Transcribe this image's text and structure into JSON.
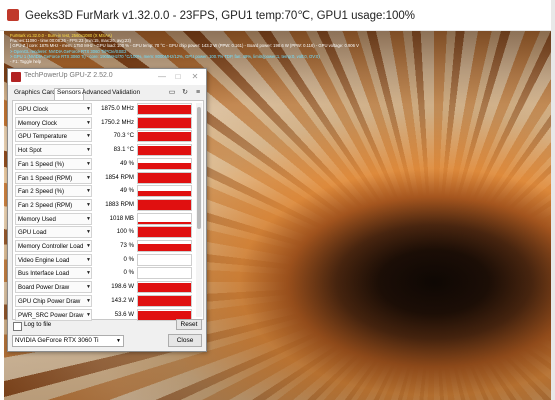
{
  "furmark": {
    "title": "Geeks3D FurMark v1.32.0.0 - 23FPS, GPU1 temp:70℃, GPU1 usage:100%",
    "overlay": [
      {
        "text": "FurMark v1.32.0.0 - Burn-in test, 2560x1080 (X MSAA)",
        "color": "yellow"
      },
      {
        "text": "Frames:11090 - time:00:08:26 - FPS:23 (min:15, max:26, avg:23)",
        "color": "white"
      },
      {
        "text": "[ GPU-Z ] core: 1875 MHz - mem: 1750 MHz - GPU load: 100 % - GPU temp: 70 °C - GPU chip power: 143.2 W (PPW: 0.161) - Board power: 198.6 W (PPW: 0.116) - GPU voltage: 0.906 V",
        "color": "white"
      },
      {
        "text": "> OpenGL renderer: NVIDIA GeForce RTX 3060 Ti/PCIe/SSE2",
        "color": "cyan"
      },
      {
        "text": "> GPU 1 (NVIDIA GeForce RTX 3060 Ti) - core: 1905MHz/70 °C/100%, mem: 8000MHz/12%, GPU power: 100.7% TDP, fan: 49%, limits(power:1, temp:0, volt:0, OV:0)",
        "color": "cyan"
      },
      {
        "text": "- F1: Toggle help",
        "color": "white"
      }
    ]
  },
  "gpuz": {
    "title": "TechPowerUp GPU-Z 2.52.0",
    "window_buttons": [
      "—",
      "□",
      "✕"
    ],
    "tabs": [
      "Graphics Card",
      "Sensors",
      "Advanced",
      "Validation"
    ],
    "active_tab": "Sensors",
    "sensors": [
      {
        "name": "GPU Clock",
        "value": "1875.0 MHz",
        "level": 0.95
      },
      {
        "name": "Memory Clock",
        "value": "1750.2 MHz",
        "level": 0.95
      },
      {
        "name": "GPU Temperature",
        "value": "70.3 °C",
        "level": 0.9
      },
      {
        "name": "Hot Spot",
        "value": "83.1 °C",
        "level": 0.9
      },
      {
        "name": "Fan 1 Speed (%)",
        "value": "49 %",
        "level": 0.55
      },
      {
        "name": "Fan 1 Speed (RPM)",
        "value": "1854 RPM",
        "level": 0.95
      },
      {
        "name": "Fan 2 Speed (%)",
        "value": "49 %",
        "level": 0.55
      },
      {
        "name": "Fan 2 Speed (RPM)",
        "value": "1883 RPM",
        "level": 0.95
      },
      {
        "name": "Memory Used",
        "value": "1018 MB",
        "level": 0.12
      },
      {
        "name": "GPU Load",
        "value": "100 %",
        "level": 1.0
      },
      {
        "name": "Memory Controller Load",
        "value": "73 %",
        "level": 0.73
      },
      {
        "name": "Video Engine Load",
        "value": "0 %",
        "level": 0.0
      },
      {
        "name": "Bus Interface Load",
        "value": "0 %",
        "level": 0.0
      },
      {
        "name": "Board Power Draw",
        "value": "198.6 W",
        "level": 0.95
      },
      {
        "name": "GPU Chip Power Draw",
        "value": "143.2 W",
        "level": 0.95
      },
      {
        "name": "PWR_SRC Power Draw",
        "value": "53.6 W",
        "level": 0.85
      }
    ],
    "log_to_file_label": "Log to file",
    "reset_label": "Reset",
    "gpu_select": "NVIDIA GeForce RTX 3060 Ti",
    "close_label": "Close",
    "accent": "#e01010"
  }
}
